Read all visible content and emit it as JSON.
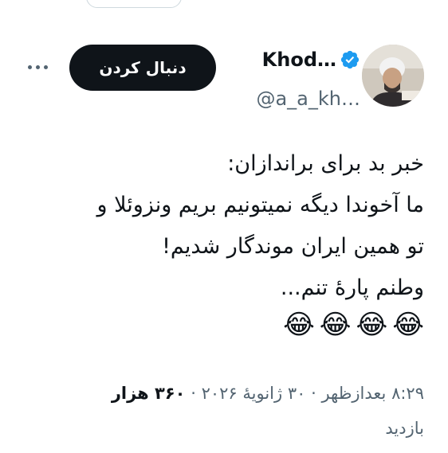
{
  "author": {
    "display_name": "Khod…",
    "handle": "@a_a_kh…"
  },
  "follow_label": "دنبال کردن",
  "tweet": {
    "lines": [
      "خبر بد برای براندازان:",
      "ما آخوندا دیگه نمیتونیم بریم ونزوئلا و",
      "تو همین ایران موندگار شدیم!",
      "وطنم پارهٔ تنم..."
    ],
    "emojis": [
      "😂",
      "😂",
      "😂",
      "😂"
    ]
  },
  "meta": {
    "time": "۸:۲۹ بعدازظهر",
    "date": "۳۰ ژانویهٔ ۲۰۲۶",
    "views_count": "۳۶۰ هزار",
    "views_label": "بازدید",
    "separator": "·"
  },
  "colors": {
    "verified": "#1d9bf0",
    "follow_bg": "#0f1419",
    "secondary_text": "#536471"
  }
}
